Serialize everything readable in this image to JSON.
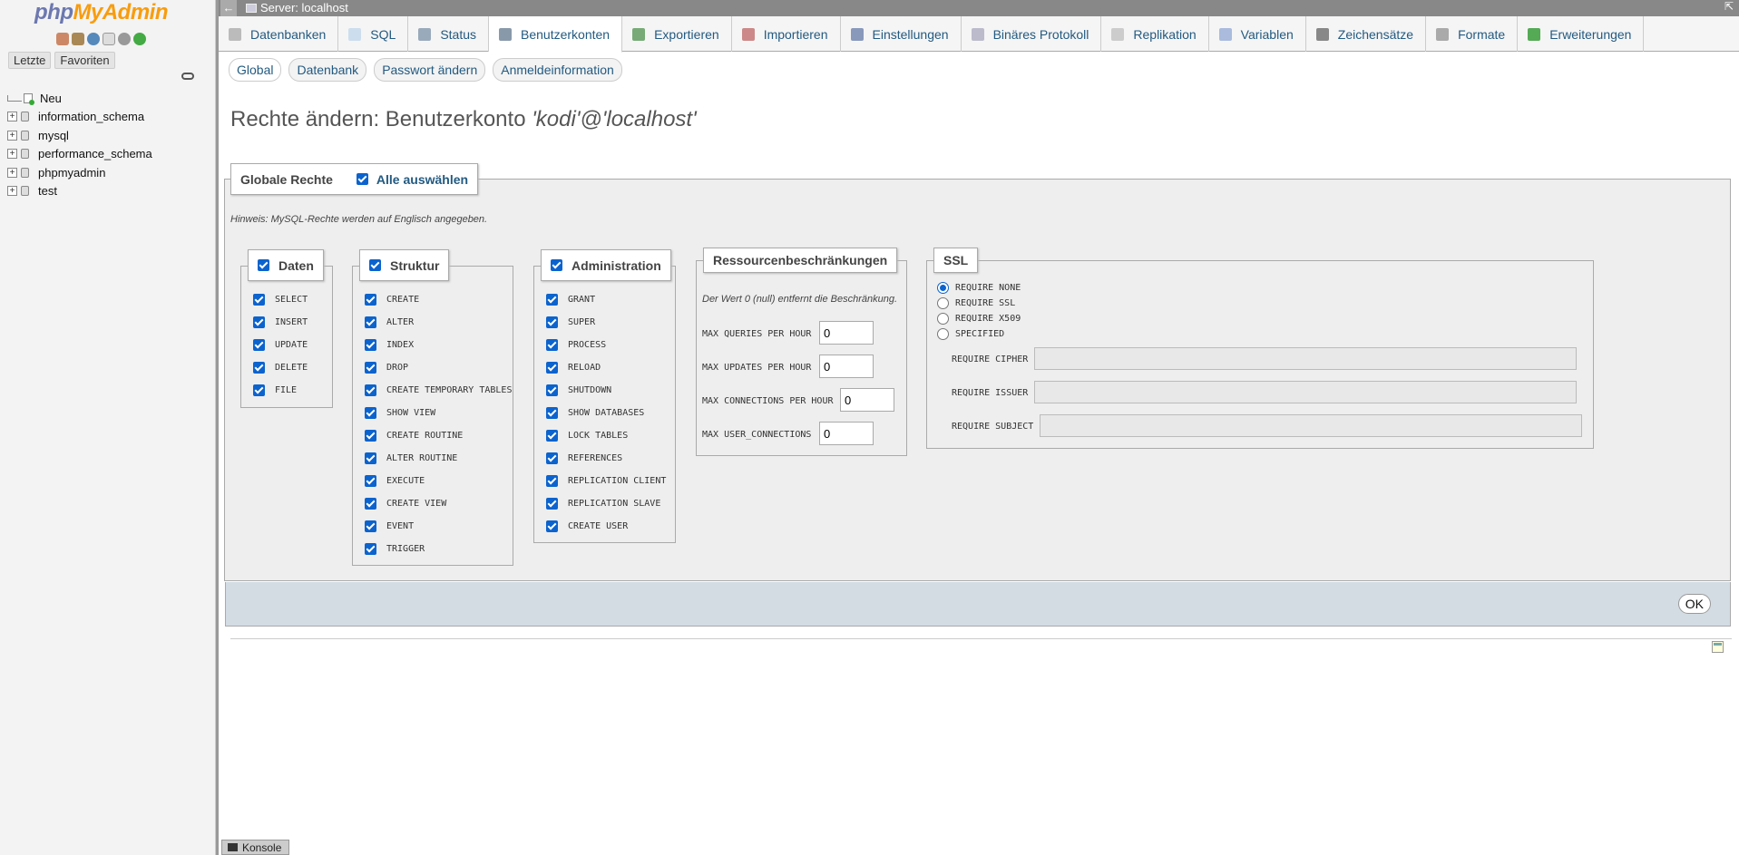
{
  "app": {
    "brand_php": "php",
    "brand_myadmin": "MyAdmin"
  },
  "sidebar": {
    "tabs": [
      "Letzte",
      "Favoriten"
    ],
    "tree": [
      {
        "label": "Neu",
        "expander": ""
      },
      {
        "label": "information_schema",
        "expander": "+"
      },
      {
        "label": "mysql",
        "expander": "+"
      },
      {
        "label": "performance_schema",
        "expander": "+"
      },
      {
        "label": "phpmyadmin",
        "expander": "+"
      },
      {
        "label": "test",
        "expander": "+"
      }
    ]
  },
  "topbar": {
    "back": "←",
    "server": "Server: localhost",
    "collapse": "⇱"
  },
  "menu": {
    "tabs": [
      {
        "label": "Datenbanken",
        "icon": "database-icon",
        "active": false
      },
      {
        "label": "SQL",
        "icon": "sql-icon",
        "active": false
      },
      {
        "label": "Status",
        "icon": "status-icon",
        "active": false
      },
      {
        "label": "Benutzerkonten",
        "icon": "users-icon",
        "active": true
      },
      {
        "label": "Exportieren",
        "icon": "export-icon",
        "active": false
      },
      {
        "label": "Importieren",
        "icon": "import-icon",
        "active": false
      },
      {
        "label": "Einstellungen",
        "icon": "wrench-icon",
        "active": false
      },
      {
        "label": "Binäres Protokoll",
        "icon": "binlog-icon",
        "active": false
      },
      {
        "label": "Replikation",
        "icon": "replication-icon",
        "active": false
      },
      {
        "label": "Variablen",
        "icon": "variables-icon",
        "active": false
      },
      {
        "label": "Zeichensätze",
        "icon": "charset-icon",
        "active": false
      },
      {
        "label": "Formate",
        "icon": "formats-icon",
        "active": false
      },
      {
        "label": "Erweiterungen",
        "icon": "puzzle-icon",
        "active": false
      }
    ]
  },
  "submenu": {
    "tabs": [
      "Global",
      "Datenbank",
      "Passwort ändern",
      "Anmeldeinformation"
    ],
    "active": "Global"
  },
  "page": {
    "title_prefix": "Rechte ändern: Benutzerkonto ",
    "title_account": "'kodi'@'localhost'"
  },
  "privileges": {
    "legend": "Globale Rechte",
    "select_all": "Alle auswählen",
    "hint": "Hinweis: MySQL-Rechte werden auf Englisch angegeben.",
    "groups": {
      "daten": {
        "label": "Daten",
        "items": [
          "SELECT",
          "INSERT",
          "UPDATE",
          "DELETE",
          "FILE"
        ]
      },
      "struktur": {
        "label": "Struktur",
        "items": [
          "CREATE",
          "ALTER",
          "INDEX",
          "DROP",
          "CREATE TEMPORARY TABLES",
          "SHOW VIEW",
          "CREATE ROUTINE",
          "ALTER ROUTINE",
          "EXECUTE",
          "CREATE VIEW",
          "EVENT",
          "TRIGGER"
        ]
      },
      "administration": {
        "label": "Administration",
        "items": [
          "GRANT",
          "SUPER",
          "PROCESS",
          "RELOAD",
          "SHUTDOWN",
          "SHOW DATABASES",
          "LOCK TABLES",
          "REFERENCES",
          "REPLICATION CLIENT",
          "REPLICATION SLAVE",
          "CREATE USER"
        ]
      }
    },
    "resources": {
      "label": "Ressourcenbeschränkungen",
      "hint": "Der Wert 0 (null) entfernt die Beschränkung.",
      "fields": [
        {
          "label": "MAX QUERIES PER HOUR",
          "value": "0"
        },
        {
          "label": "MAX UPDATES PER HOUR",
          "value": "0"
        },
        {
          "label": "MAX CONNECTIONS PER HOUR",
          "value": "0"
        },
        {
          "label": "MAX USER_CONNECTIONS",
          "value": "0"
        }
      ]
    },
    "ssl": {
      "label": "SSL",
      "options": [
        "REQUIRE NONE",
        "REQUIRE SSL",
        "REQUIRE X509",
        "SPECIFIED"
      ],
      "selected": "REQUIRE NONE",
      "fields": [
        {
          "label": "REQUIRE CIPHER",
          "value": ""
        },
        {
          "label": "REQUIRE ISSUER",
          "value": ""
        },
        {
          "label": "REQUIRE SUBJECT",
          "value": ""
        }
      ]
    },
    "ok": "OK"
  },
  "console": "Konsole"
}
